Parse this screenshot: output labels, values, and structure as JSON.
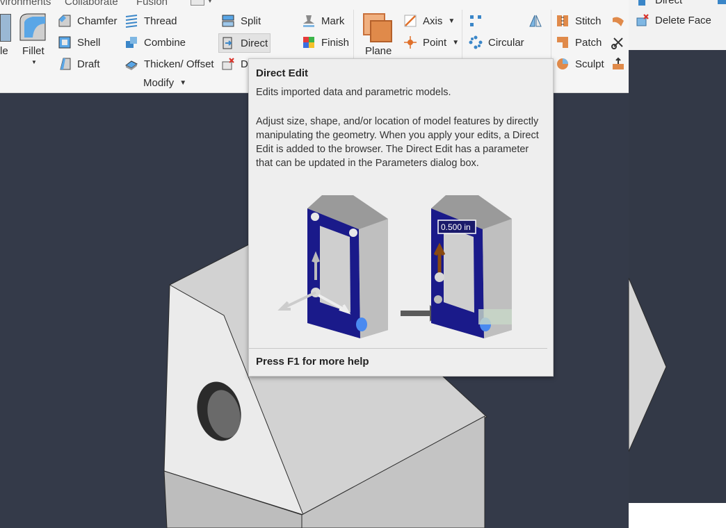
{
  "ribbon": {
    "tabs": [
      "vironments",
      "Collaborate",
      "Fusion"
    ],
    "modify": {
      "fillet_cut_label": "le",
      "fillet_label": "Fillet",
      "chamfer": "Chamfer",
      "shell": "Shell",
      "draft": "Draft",
      "thread": "Thread",
      "combine": "Combine",
      "thicken": "Thicken/ Offset",
      "split": "Split",
      "direct": "Direct",
      "delete_partial": "D",
      "mark": "Mark",
      "finish": "Finish",
      "group_label": "Modify"
    },
    "work_features": {
      "plane": "Plane",
      "axis": "Axis",
      "point": "Point"
    },
    "pattern": {
      "circular": "Circular"
    },
    "surface": {
      "stitch": "Stitch",
      "patch": "Patch",
      "sculpt": "Sculpt"
    }
  },
  "right_panel": {
    "direct_partial": "Direct",
    "delete_face": "Delete Face"
  },
  "tooltip": {
    "title": "Direct Edit",
    "summary": "Edits imported data and parametric models.",
    "description": "Adjust size, shape, and/or location of model features by directly manipulating the geometry. When you apply your edits, a Direct Edit is added to the browser. The Direct Edit has a parameter that can be updated in the Parameters dialog box.",
    "dimension_label": "0.500 in",
    "footer": "Press F1 for more help"
  },
  "colors": {
    "viewport_bg": "#343a49",
    "ribbon_bg": "#f5f5f5",
    "tooltip_bg": "#eeeeee",
    "accent_orange": "#e08a4a",
    "icon_blue": "#3a86c8"
  }
}
